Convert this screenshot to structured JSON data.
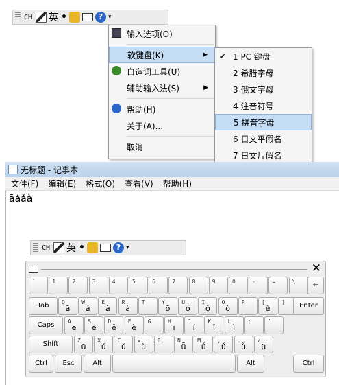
{
  "ime_bar": {
    "ch": "CH",
    "lang": "英",
    "dot": "•",
    "help": "?",
    "arrow": "▾"
  },
  "menu": {
    "items": [
      {
        "label": "输入选项(O)",
        "icon": "settings-icon"
      },
      {
        "label": "软键盘(K)",
        "submenu": true,
        "highlight": true
      },
      {
        "label": "自造词工具(U)",
        "icon": "leaf-icon"
      },
      {
        "label": "辅助输入法(S)",
        "submenu": true
      },
      {
        "label": "帮助(H)",
        "icon": "help-icon"
      },
      {
        "label": "关于(A)..."
      },
      {
        "label": "取消"
      }
    ],
    "submenu_arrow": "▶"
  },
  "submenu": {
    "check": "✔",
    "items": [
      "1 PC 键盘",
      "2 希腊字母",
      "3 俄文字母",
      "4 注音符号",
      "5 拼音字母",
      "6 日文平假名",
      "7 日文片假名"
    ],
    "highlighted_index": 4
  },
  "notepad": {
    "title": "无标题 - 记事本",
    "menus": [
      "文件(F)",
      "编辑(E)",
      "格式(O)",
      "查看(V)",
      "帮助(H)"
    ],
    "content": "āáǎà"
  },
  "keyboard": {
    "close": "✕",
    "rows": [
      [
        [
          "`",
          ""
        ],
        [
          "1",
          ""
        ],
        [
          "2",
          ""
        ],
        [
          "3",
          ""
        ],
        [
          "4",
          ""
        ],
        [
          "5",
          ""
        ],
        [
          "6",
          ""
        ],
        [
          "7",
          ""
        ],
        [
          "8",
          ""
        ],
        [
          "9",
          ""
        ],
        [
          "0",
          ""
        ],
        [
          "-",
          ""
        ],
        [
          "=",
          ""
        ],
        [
          "\\",
          ""
        ]
      ],
      [
        [
          "Q",
          "ā"
        ],
        [
          "W",
          "á"
        ],
        [
          "E",
          "ǎ"
        ],
        [
          "R",
          "à"
        ],
        [
          "T",
          ""
        ],
        [
          "Y",
          "ō"
        ],
        [
          "U",
          "ó"
        ],
        [
          "I",
          "ǒ"
        ],
        [
          "O",
          "ò"
        ],
        [
          "P",
          ""
        ],
        [
          "[",
          "ê"
        ],
        [
          "]",
          ""
        ]
      ],
      [
        [
          "A",
          "ē"
        ],
        [
          "S",
          "é"
        ],
        [
          "D",
          "ě"
        ],
        [
          "F",
          "è"
        ],
        [
          "G",
          ""
        ],
        [
          "H",
          "ī"
        ],
        [
          "J",
          "í"
        ],
        [
          "K",
          "ǐ"
        ],
        [
          "L",
          "ì"
        ],
        [
          ";",
          ""
        ],
        [
          "'",
          ""
        ]
      ],
      [
        [
          "Z",
          "ū"
        ],
        [
          "X",
          "ú"
        ],
        [
          "C",
          "ǔ"
        ],
        [
          "V",
          "ù"
        ],
        [
          "B",
          ""
        ],
        [
          "N",
          "ǖ"
        ],
        [
          "M",
          "ǘ"
        ],
        [
          ",",
          "ǚ"
        ],
        [
          ".",
          "ǜ"
        ],
        [
          "/",
          "ü"
        ]
      ]
    ],
    "special": {
      "back": "←",
      "tab": "Tab",
      "caps": "Caps",
      "enter": "Enter",
      "shift": "Shift",
      "ctrl": "Ctrl",
      "esc": "Esc",
      "alt": "Alt"
    }
  }
}
